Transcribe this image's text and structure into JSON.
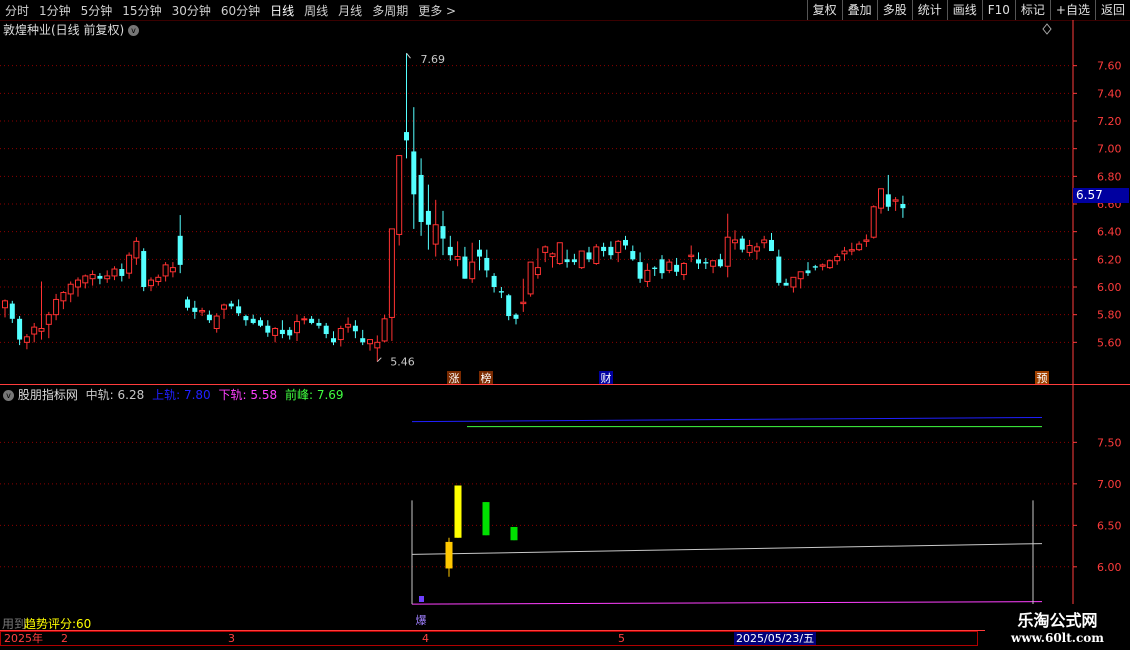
{
  "toolbar": {
    "periods": [
      "分时",
      "1分钟",
      "5分钟",
      "15分钟",
      "30分钟",
      "60分钟",
      "日线",
      "周线",
      "月线",
      "多周期",
      "更多 >"
    ],
    "active_period": "日线",
    "buttons": [
      "复权",
      "叠加",
      "多股",
      "统计",
      "画线",
      "F10",
      "标记",
      "+自选",
      "返回"
    ]
  },
  "main": {
    "title": "敦煌种业(日线 前复权)",
    "high_label": "7.69",
    "low_label": "5.46",
    "current_price": "6.57",
    "price_ticks": [
      "7.60",
      "7.40",
      "7.20",
      "7.00",
      "6.80",
      "6.60",
      "6.40",
      "6.20",
      "6.00",
      "5.80",
      "5.60"
    ],
    "event_marks": [
      {
        "label": "涨",
        "color": "#ffffff",
        "bg": "#7a2a00"
      },
      {
        "label": "榜",
        "color": "#ffffff",
        "bg": "#7a2a00"
      },
      {
        "label": "财",
        "color": "#ffffff",
        "bg": "#0000a0"
      },
      {
        "label": "预",
        "color": "#ffffff",
        "bg": "#a04000"
      }
    ],
    "arrow_icon": "chevron-down-icon",
    "diamond_icon": "diamond-icon"
  },
  "indicator": {
    "name": "股朋指标网",
    "mid_label": "中轨:",
    "mid_value": "6.28",
    "upper_label": "上轨:",
    "upper_value": "7.80",
    "lower_label": "下轨:",
    "lower_value": "5.58",
    "peak_label": "前峰:",
    "peak_value": "7.69",
    "ticks": [
      "7.50",
      "7.00",
      "6.50",
      "6.00"
    ],
    "burst_label": "爆",
    "trend_score": "趋势评分:60",
    "ghost_text": "用到",
    "colors": {
      "mid": "#c8c8c8",
      "upper": "#2020ff",
      "lower": "#ff40ff",
      "peak": "#40ff40"
    }
  },
  "dates": {
    "year": "2025年",
    "months": [
      "2",
      "3",
      "4",
      "5"
    ],
    "selected": "2025/05/23/五"
  },
  "watermark": {
    "line1": "乐淘公式网",
    "line2": "www.60lt.com"
  },
  "colors": {
    "up": "#ff3232",
    "down": "#54ffff",
    "grid": "#8b0000",
    "axis": "#ff3c3c",
    "bg": "#000000"
  },
  "chart_data": [
    {
      "type": "candlestick",
      "title": "敦煌种业(日线 前复权)",
      "ylim": [
        5.4,
        7.8
      ],
      "ohlc": [
        [
          5.85,
          5.91,
          5.78,
          5.9
        ],
        [
          5.88,
          5.9,
          5.74,
          5.77
        ],
        [
          5.77,
          5.79,
          5.58,
          5.62
        ],
        [
          5.6,
          5.66,
          5.55,
          5.64
        ],
        [
          5.66,
          5.74,
          5.6,
          5.71
        ],
        [
          5.68,
          6.04,
          5.62,
          5.7
        ],
        [
          5.73,
          5.82,
          5.63,
          5.8
        ],
        [
          5.8,
          5.95,
          5.76,
          5.91
        ],
        [
          5.9,
          5.97,
          5.84,
          5.96
        ],
        [
          5.95,
          6.04,
          5.89,
          6.02
        ],
        [
          6.0,
          6.07,
          5.93,
          6.05
        ],
        [
          6.03,
          6.09,
          5.99,
          6.08
        ],
        [
          6.06,
          6.12,
          6.01,
          6.09
        ],
        [
          6.08,
          6.1,
          6.02,
          6.06
        ],
        [
          6.06,
          6.12,
          6.03,
          6.08
        ],
        [
          6.08,
          6.15,
          6.05,
          6.13
        ],
        [
          6.13,
          6.17,
          6.04,
          6.08
        ],
        [
          6.1,
          6.25,
          6.06,
          6.23
        ],
        [
          6.21,
          6.36,
          6.16,
          6.33
        ],
        [
          6.26,
          6.28,
          5.97,
          6.0
        ],
        [
          6.01,
          6.07,
          5.97,
          6.05
        ],
        [
          6.04,
          6.09,
          6.01,
          6.07
        ],
        [
          6.08,
          6.18,
          6.04,
          6.16
        ],
        [
          6.11,
          6.18,
          6.07,
          6.14
        ],
        [
          6.37,
          6.52,
          6.1,
          6.16
        ],
        [
          5.91,
          5.93,
          5.83,
          5.85
        ],
        [
          5.85,
          5.9,
          5.77,
          5.82
        ],
        [
          5.82,
          5.85,
          5.79,
          5.83
        ],
        [
          5.8,
          5.83,
          5.74,
          5.76
        ],
        [
          5.7,
          5.81,
          5.67,
          5.79
        ],
        [
          5.84,
          5.88,
          5.77,
          5.87
        ],
        [
          5.88,
          5.9,
          5.84,
          5.86
        ],
        [
          5.86,
          5.91,
          5.79,
          5.81
        ],
        [
          5.79,
          5.8,
          5.72,
          5.76
        ],
        [
          5.77,
          5.8,
          5.73,
          5.74
        ],
        [
          5.76,
          5.78,
          5.71,
          5.72
        ],
        [
          5.72,
          5.76,
          5.64,
          5.67
        ],
        [
          5.65,
          5.71,
          5.6,
          5.7
        ],
        [
          5.69,
          5.76,
          5.63,
          5.66
        ],
        [
          5.69,
          5.71,
          5.62,
          5.65
        ],
        [
          5.67,
          5.8,
          5.61,
          5.75
        ],
        [
          5.77,
          5.79,
          5.73,
          5.77
        ],
        [
          5.77,
          5.79,
          5.73,
          5.74
        ],
        [
          5.74,
          5.77,
          5.7,
          5.72
        ],
        [
          5.72,
          5.74,
          5.63,
          5.66
        ],
        [
          5.63,
          5.68,
          5.58,
          5.6
        ],
        [
          5.62,
          5.72,
          5.57,
          5.7
        ],
        [
          5.71,
          5.78,
          5.67,
          5.73
        ],
        [
          5.72,
          5.76,
          5.63,
          5.68
        ],
        [
          5.63,
          5.69,
          5.58,
          5.6
        ],
        [
          5.59,
          5.61,
          5.54,
          5.62
        ],
        [
          5.56,
          5.65,
          5.46,
          5.6
        ],
        [
          5.61,
          5.8,
          5.6,
          5.77
        ],
        [
          5.78,
          6.36,
          5.61,
          6.42
        ],
        [
          6.38,
          6.95,
          6.3,
          6.95
        ],
        [
          7.12,
          7.69,
          6.93,
          7.06
        ],
        [
          6.98,
          7.3,
          6.42,
          6.67
        ],
        [
          6.81,
          6.93,
          6.37,
          6.47
        ],
        [
          6.55,
          6.74,
          6.27,
          6.45
        ],
        [
          6.31,
          6.63,
          6.22,
          6.45
        ],
        [
          6.44,
          6.55,
          6.23,
          6.35
        ],
        [
          6.29,
          6.37,
          6.19,
          6.23
        ],
        [
          6.2,
          6.33,
          6.15,
          6.22
        ],
        [
          6.22,
          6.29,
          6.06,
          6.06
        ],
        [
          6.06,
          6.32,
          6.03,
          6.18
        ],
        [
          6.27,
          6.34,
          6.12,
          6.22
        ],
        [
          6.21,
          6.27,
          6.07,
          6.12
        ],
        [
          6.08,
          6.1,
          5.96,
          6.0
        ],
        [
          5.97,
          6.0,
          5.92,
          5.96
        ],
        [
          5.94,
          5.95,
          5.76,
          5.79
        ],
        [
          5.8,
          5.81,
          5.73,
          5.77
        ],
        [
          5.88,
          6.06,
          5.82,
          5.89
        ],
        [
          5.95,
          6.14,
          5.93,
          6.18
        ],
        [
          6.09,
          6.28,
          6.06,
          6.14
        ],
        [
          6.25,
          6.3,
          6.18,
          6.29
        ],
        [
          6.22,
          6.25,
          6.14,
          6.24
        ],
        [
          6.17,
          6.32,
          6.16,
          6.32
        ],
        [
          6.2,
          6.27,
          6.14,
          6.18
        ],
        [
          6.2,
          6.24,
          6.16,
          6.18
        ],
        [
          6.14,
          6.26,
          6.13,
          6.26
        ],
        [
          6.25,
          6.29,
          6.18,
          6.2
        ],
        [
          6.17,
          6.31,
          6.16,
          6.29
        ],
        [
          6.29,
          6.32,
          6.22,
          6.26
        ],
        [
          6.29,
          6.33,
          6.2,
          6.23
        ],
        [
          6.25,
          6.34,
          6.18,
          6.33
        ],
        [
          6.34,
          6.37,
          6.27,
          6.3
        ],
        [
          6.26,
          6.3,
          6.19,
          6.2
        ],
        [
          6.18,
          6.25,
          6.03,
          6.06
        ],
        [
          6.04,
          6.17,
          6.0,
          6.12
        ],
        [
          6.14,
          6.15,
          6.08,
          6.13
        ],
        [
          6.2,
          6.23,
          6.06,
          6.1
        ],
        [
          6.12,
          6.2,
          6.1,
          6.18
        ],
        [
          6.16,
          6.21,
          6.08,
          6.11
        ],
        [
          6.09,
          6.18,
          6.05,
          6.17
        ],
        [
          6.22,
          6.3,
          6.18,
          6.23
        ],
        [
          6.2,
          6.25,
          6.13,
          6.17
        ],
        [
          6.18,
          6.21,
          6.13,
          6.17
        ],
        [
          6.15,
          6.19,
          6.1,
          6.19
        ],
        [
          6.2,
          6.24,
          6.14,
          6.15
        ],
        [
          6.15,
          6.53,
          6.07,
          6.36
        ],
        [
          6.32,
          6.41,
          6.27,
          6.34
        ],
        [
          6.35,
          6.37,
          6.25,
          6.27
        ],
        [
          6.25,
          6.34,
          6.22,
          6.3
        ],
        [
          6.26,
          6.32,
          6.2,
          6.29
        ],
        [
          6.32,
          6.37,
          6.28,
          6.34
        ],
        [
          6.34,
          6.39,
          6.28,
          6.26
        ],
        [
          6.22,
          6.27,
          6.01,
          6.03
        ],
        [
          6.03,
          6.06,
          6.01,
          6.01
        ],
        [
          6.0,
          6.05,
          5.96,
          6.07
        ],
        [
          6.06,
          6.11,
          5.99,
          6.11
        ],
        [
          6.12,
          6.18,
          6.08,
          6.1
        ],
        [
          6.15,
          6.16,
          6.12,
          6.14
        ],
        [
          6.15,
          6.17,
          6.12,
          6.16
        ],
        [
          6.14,
          6.2,
          6.13,
          6.19
        ],
        [
          6.19,
          6.24,
          6.16,
          6.22
        ],
        [
          6.24,
          6.29,
          6.19,
          6.26
        ],
        [
          6.26,
          6.32,
          6.23,
          6.27
        ],
        [
          6.27,
          6.33,
          6.26,
          6.31
        ],
        [
          6.33,
          6.38,
          6.29,
          6.34
        ],
        [
          6.36,
          6.59,
          6.35,
          6.58
        ],
        [
          6.57,
          6.71,
          6.53,
          6.71
        ],
        [
          6.67,
          6.81,
          6.55,
          6.58
        ],
        [
          6.62,
          6.65,
          6.55,
          6.63
        ],
        [
          6.6,
          6.66,
          6.5,
          6.57
        ]
      ]
    },
    {
      "type": "line",
      "title": "股朋指标网",
      "ylim": [
        5.6,
        7.95
      ],
      "series": [
        {
          "name": "中轨",
          "values": [
            6.15,
            6.28
          ],
          "color": "#c8c8c8"
        },
        {
          "name": "上轨",
          "values": [
            7.75,
            7.8
          ],
          "color": "#2020ff"
        },
        {
          "name": "下轨",
          "values": [
            5.55,
            5.58
          ],
          "color": "#ff40ff"
        },
        {
          "name": "前峰",
          "values": [
            7.69,
            7.69
          ],
          "color": "#40ff40"
        }
      ],
      "bars": [
        {
          "open": 6.3,
          "close": 5.98,
          "high": 6.35,
          "low": 5.88,
          "color": "#ffc800"
        },
        {
          "open": 6.35,
          "close": 6.98,
          "high": 6.98,
          "low": 6.35,
          "color": "#ffff00"
        },
        {
          "open": 6.38,
          "close": 6.78,
          "high": 6.78,
          "low": 6.38,
          "color": "#00e000"
        },
        {
          "open": 6.32,
          "close": 6.48,
          "high": 6.48,
          "low": 6.32,
          "color": "#00e000"
        }
      ]
    }
  ]
}
